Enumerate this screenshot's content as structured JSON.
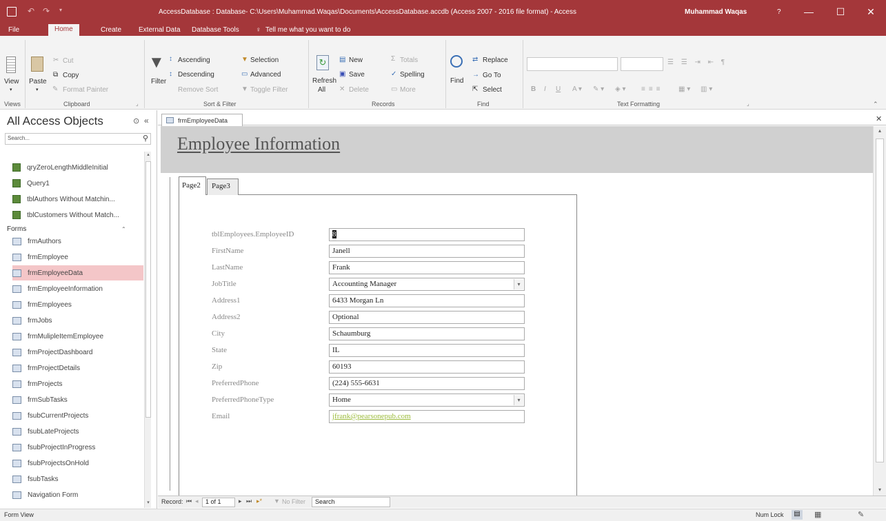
{
  "titlebar": {
    "title": "AccessDatabase : Database- C:\\Users\\Muhammad.Waqas\\Documents\\AccessDatabase.accdb (Access 2007 - 2016 file format) - Access",
    "user": "Muhammad Waqas",
    "help": "?",
    "min": "—",
    "max": "☐",
    "close": "✕"
  },
  "tabs": {
    "file": "File",
    "home": "Home",
    "create": "Create",
    "external": "External Data",
    "dbtools": "Database Tools",
    "tell": "Tell me what you want to do"
  },
  "ribbon": {
    "view": "View",
    "paste": "Paste",
    "cut": "Cut",
    "copy": "Copy",
    "format_painter": "Format Painter",
    "filter": "Filter",
    "ascending": "Ascending",
    "descending": "Descending",
    "remove_sort": "Remove Sort",
    "selection": "Selection",
    "advanced": "Advanced",
    "toggle_filter": "Toggle Filter",
    "refresh": "Refresh",
    "refresh_all": "All",
    "new": "New",
    "save": "Save",
    "delete": "Delete",
    "totals": "Totals",
    "spelling": "Spelling",
    "more": "More",
    "find": "Find",
    "replace": "Replace",
    "goto": "Go To",
    "select": "Select",
    "groups": {
      "views": "Views",
      "clipboard": "Clipboard",
      "sort": "Sort & Filter",
      "records": "Records",
      "find": "Find",
      "text": "Text Formatting"
    }
  },
  "nav": {
    "title": "All Access Objects",
    "search_placeholder": "Search...",
    "items_top": [
      "qryZeroLengthMiddleInitial",
      "Query1",
      "tblAuthors Without Matchin...",
      "tblCustomers Without Match..."
    ],
    "forms_header": "Forms",
    "forms": [
      "frmAuthors",
      "frmEmployee",
      "frmEmployeeData",
      "frmEmployeeInformation",
      "frmEmployees",
      "frmJobs",
      "frmMulipleItemEmployee",
      "frmProjectDashboard",
      "frmProjectDetails",
      "frmProjects",
      "frmSubTasks",
      "fsubCurrentProjects",
      "fsubLateProjects",
      "fsubProjectInProgress",
      "fsubProjectsOnHold",
      "fsubTasks",
      "Navigation Form"
    ]
  },
  "document": {
    "tab": "frmEmployeeData",
    "form_title": "Employee Information",
    "pages": [
      "Page2",
      "Page3"
    ],
    "fields": [
      {
        "label": "tblEmployees.EmployeeID",
        "value": "8",
        "combo": false
      },
      {
        "label": "FirstName",
        "value": "Janell",
        "combo": false
      },
      {
        "label": "LastName",
        "value": "Frank",
        "combo": false
      },
      {
        "label": "JobTitle",
        "value": "Accounting Manager",
        "combo": true
      },
      {
        "label": "Address1",
        "value": "6433 Morgan Ln",
        "combo": false
      },
      {
        "label": "Address2",
        "value": "Optional",
        "combo": false
      },
      {
        "label": "City",
        "value": "Schaumburg",
        "combo": false
      },
      {
        "label": "State",
        "value": "IL",
        "combo": false
      },
      {
        "label": "Zip",
        "value": "60193",
        "combo": false
      },
      {
        "label": "PreferredPhone",
        "value": "(224) 555-6631",
        "combo": false
      },
      {
        "label": "PreferredPhoneType",
        "value": "Home",
        "combo": true
      },
      {
        "label": "Email",
        "value": "jfrank@pearsonepub.com",
        "combo": false
      }
    ]
  },
  "recnav": {
    "record": "Record:",
    "position": "1 of 1",
    "nofilter": "No Filter",
    "search": "Search"
  },
  "status": {
    "left": "Form View",
    "numlock": "Num Lock"
  }
}
